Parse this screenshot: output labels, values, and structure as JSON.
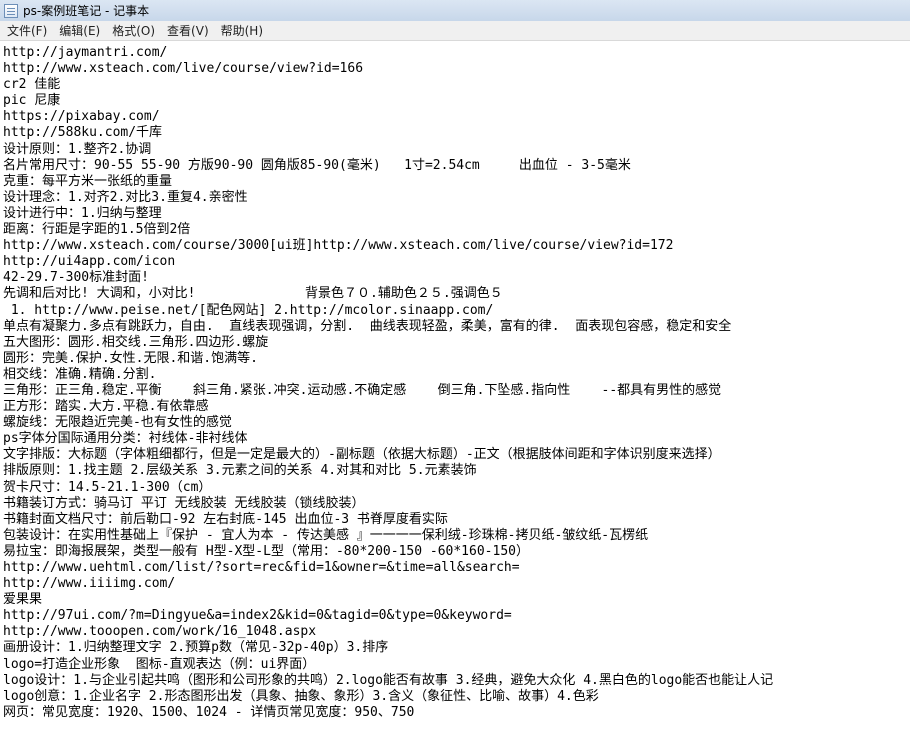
{
  "window": {
    "title": "ps-案例班笔记 - 记事本"
  },
  "menu": [
    "文件(F)",
    "编辑(E)",
    "格式(O)",
    "查看(V)",
    "帮助(H)"
  ],
  "document": {
    "lines": [
      "http://jaymantri.com/",
      "http://www.xsteach.com/live/course/view?id=166",
      "cr2 佳能",
      "pic 尼康",
      "https://pixabay.com/",
      "http://588ku.com/千库",
      "设计原则：1.整齐2.协调",
      "名片常用尺寸：90-55 55-90 方版90-90 圆角版85-90(毫米)   1寸=2.54cm     出血位 - 3-5毫米",
      "克重：每平方米一张纸的重量",
      "设计理念：1.对齐2.对比3.重复4.亲密性",
      "设计进行中：1.归纳与整理",
      "距离：行距是字距的1.5倍到2倍",
      "http://www.xsteach.com/course/3000[ui班]http://www.xsteach.com/live/course/view?id=172",
      "http://ui4app.com/icon",
      "42-29.7-300标准封面!",
      "先调和后对比! 大调和，小对比!              背景色７０.辅助色２５.强调色５",
      " 1. http://www.peise.net/[配色网站] 2.http://mcolor.sinaapp.com/",
      "单点有凝聚力.多点有跳跃力，自由.  直线表现强调，分割.  曲线表现轻盈，柔美，富有的律.  面表现包容感，稳定和安全",
      "五大图形：圆形.相交线.三角形.四边形.螺旋",
      "圆形：完美.保护.女性.无限.和谐.饱满等.",
      "相交线：准确.精确.分割.",
      "三角形：正三角.稳定.平衡    斜三角.紧张.冲突.运动感.不确定感    倒三角.下坠感.指向性    --都具有男性的感觉",
      "正方形：踏实.大方.平稳.有依靠感",
      "螺旋线：无限趋近完美-也有女性的感觉",
      "ps字体分国际通用分类：衬线体-非衬线体",
      "文字排版：大标题（字体粗细都行，但是一定是最大的）-副标题（依据大标题）-正文（根据肢体间距和字体识别度来选择）",
      "排版原则：1.找主题 2.层级关系 3.元素之间的关系 4.对其和对比 5.元素装饰",
      "贺卡尺寸：14.5-21.1-300（cm）",
      "书籍装订方式：骑马订 平订 无线胶装 无线胶装（锁线胶装）",
      "书籍封面文档尺寸：前后勒口-92 左右封底-145 出血位-3 书脊厚度看实际",
      "包装设计：在实用性基础上『保护 - 宜人为本 - 传达美感 』一一一一保利绒-珍珠棉-拷贝纸-皱纹纸-瓦楞纸",
      "易拉宝：即海报展架，类型一般有 H型-X型-L型（常用：-80*200-150 -60*160-150）",
      "http://www.uehtml.com/list/?sort=rec&fid=1&owner=&time=all&search=",
      "http://www.iiiimg.com/",
      "爱果果",
      "http://97ui.com/?m=Dingyue&a=index2&kid=0&tagid=0&type=0&keyword=",
      "http://www.tooopen.com/work/16_1048.aspx",
      "画册设计：1.归纳整理文字 2.预算p数（常见-32p-40p）3.排序",
      "logo=打造企业形象  图标-直观表达（例：ui界面）",
      "logo设计：1.与企业引起共鸣（图形和公司形象的共鸣）2.logo能否有故事 3.经典，避免大众化 4.黑白色的logo能否也能让人记",
      "logo创意：1.企业名字 2.形态图形出发（具象、抽象、象形）3.含义（象征性、比喻、故事）4.色彩",
      "网页：常见宽度：1920、1500、1024 - 详情页常见宽度：950、750"
    ]
  }
}
